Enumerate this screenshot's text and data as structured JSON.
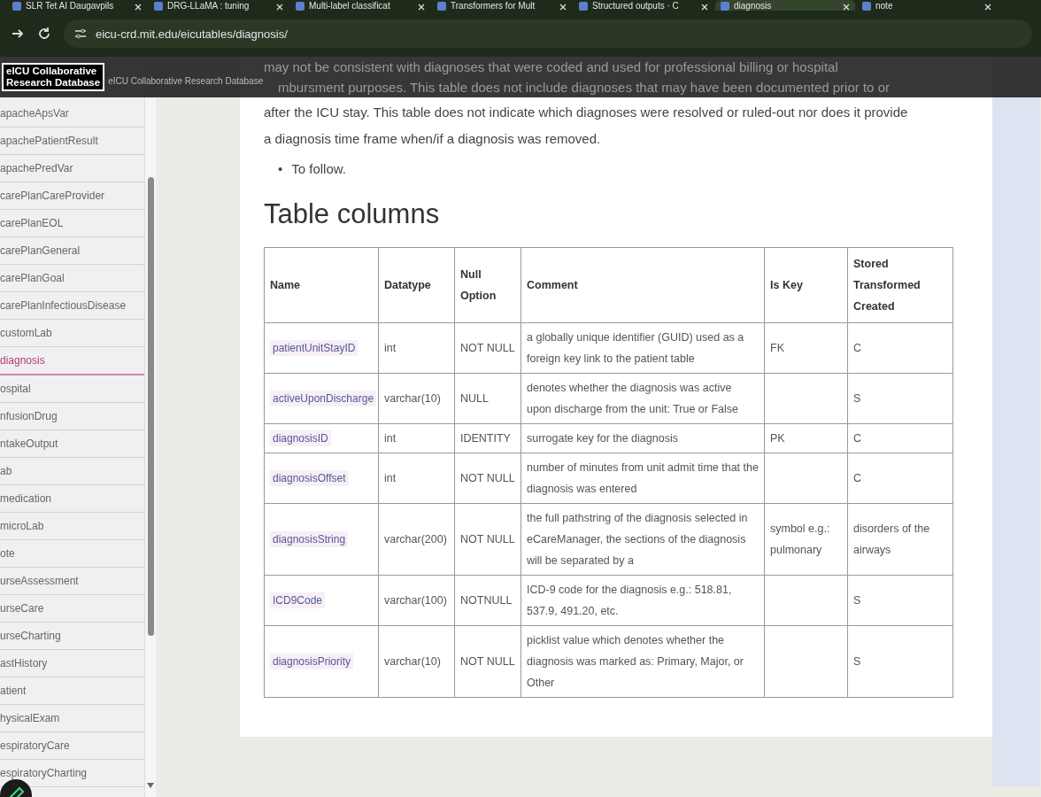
{
  "browser": {
    "tabs": [
      {
        "label": "SLR Tet AI Daugavpils",
        "selected": false
      },
      {
        "label": "DRG-LLaMA : tuning",
        "selected": false
      },
      {
        "label": "Multi-label classificat",
        "selected": false
      },
      {
        "label": "Transformers for Mult",
        "selected": false
      },
      {
        "label": "Structured outputs · C",
        "selected": false
      },
      {
        "label": "diagnosis",
        "selected": true
      },
      {
        "label": "note",
        "selected": false
      }
    ],
    "url": "eicu-crd.mit.edu/eicutables/diagnosis/"
  },
  "header": {
    "logo": [
      "eICU Collaborative",
      "Research Database"
    ],
    "subtitle": "eICU Collaborative Research Database"
  },
  "sidebar": {
    "items": [
      {
        "label": "apacheApsVar",
        "selected": false
      },
      {
        "label": "apachePatientResult",
        "selected": false
      },
      {
        "label": "apachePredVar",
        "selected": false
      },
      {
        "label": "carePlanCareProvider",
        "selected": false
      },
      {
        "label": "carePlanEOL",
        "selected": false
      },
      {
        "label": "carePlanGeneral",
        "selected": false
      },
      {
        "label": "carePlanGoal",
        "selected": false
      },
      {
        "label": "carePlanInfectiousDisease",
        "selected": false
      },
      {
        "label": "customLab",
        "selected": false
      },
      {
        "label": "diagnosis",
        "selected": true
      },
      {
        "label": "ospital",
        "selected": false
      },
      {
        "label": "nfusionDrug",
        "selected": false
      },
      {
        "label": "ntakeOutput",
        "selected": false
      },
      {
        "label": "ab",
        "selected": false
      },
      {
        "label": "medication",
        "selected": false
      },
      {
        "label": "microLab",
        "selected": false
      },
      {
        "label": "ote",
        "selected": false
      },
      {
        "label": "urseAssessment",
        "selected": false
      },
      {
        "label": "urseCare",
        "selected": false
      },
      {
        "label": "urseCharting",
        "selected": false
      },
      {
        "label": "astHistory",
        "selected": false
      },
      {
        "label": "atient",
        "selected": false
      },
      {
        "label": "hysicalExam",
        "selected": false
      },
      {
        "label": "espiratoryCare",
        "selected": false
      },
      {
        "label": "espiratoryCharting",
        "selected": false
      }
    ]
  },
  "content": {
    "hidden_lines": [
      "may not be consistent with diagnoses that were coded and used for professional billing or hospital",
      "mbursment purposes. This table does not include diagnoses that may have been documented prior to or"
    ],
    "paragraph_lines": [
      "after the ICU stay. This table does not indicate which diagnoses were resolved or ruled-out nor does it provide",
      "a diagnosis time frame when/if a diagnosis was removed."
    ],
    "bullets": [
      {
        "marker": "•",
        "text": "To follow."
      }
    ],
    "heading": "Table columns",
    "table": {
      "columns": [
        "Name",
        "Datatype",
        "Null Option",
        "Comment",
        "Is Key",
        "Stored Transformed Created"
      ],
      "rows": [
        [
          "patientUnitStayID",
          "int",
          "NOT NULL",
          "a globally unique identifier (GUID) used as a foreign key link to the patient table",
          "FK",
          "C"
        ],
        [
          "activeUponDischarge",
          "varchar(10)",
          "NULL",
          "denotes whether the diagnosis was active upon discharge from the unit: True or False",
          "",
          "S"
        ],
        [
          "diagnosisID",
          "int",
          "IDENTITY",
          "surrogate key for the diagnosis",
          "PK",
          "C"
        ],
        [
          "diagnosisOffset",
          "int",
          "NOT NULL",
          "number of minutes from unit admit time that the diagnosis was entered",
          "",
          "C"
        ],
        [
          "diagnosisString",
          "varchar(200)",
          "NOT NULL",
          "the full pathstring of the diagnosis selected in eCareManager, the sections of the diagnosis will be separated by a",
          "symbol e.g.: pulmonary",
          "disorders of the airways"
        ],
        [
          "ICD9Code",
          "varchar(100)",
          "NOTNULL",
          "ICD-9 code for the diagnosis e.g.: 518.81, 537.9, 491.20, etc.",
          "",
          "S"
        ],
        [
          "diagnosisPriority",
          "varchar(10)",
          "NOT NULL",
          "picklist value which denotes whether the diagnosis was marked as: Primary, Major, or Other",
          "",
          "S"
        ]
      ]
    }
  }
}
